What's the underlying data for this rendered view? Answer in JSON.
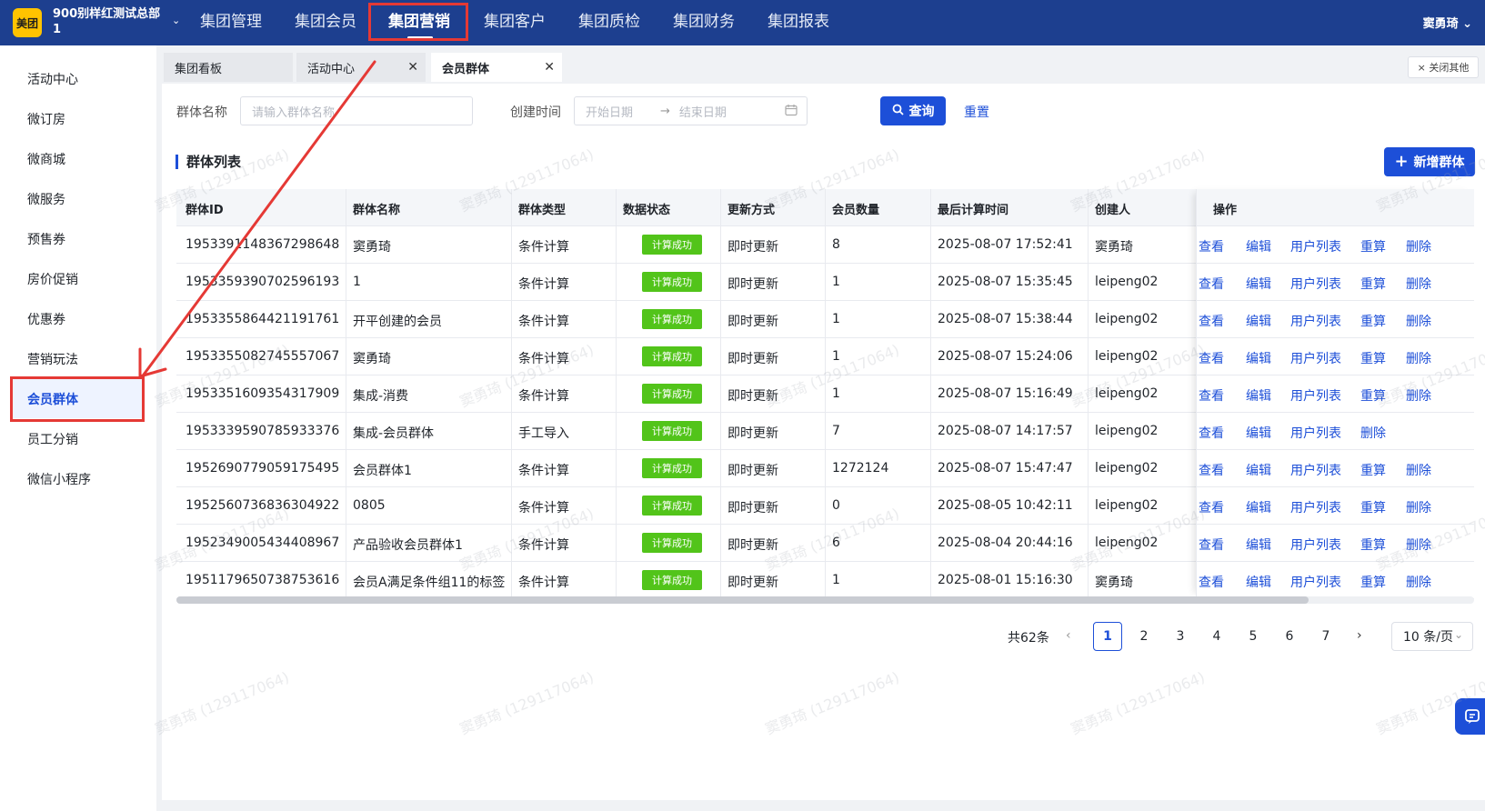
{
  "org": {
    "name_line1": "900别样红测试总部",
    "name_line2": "1",
    "logo_text": "美团"
  },
  "nav": {
    "items": [
      "集团管理",
      "集团会员",
      "集团营销",
      "集团客户",
      "集团质检",
      "集团财务",
      "集团报表"
    ],
    "active": "集团营销"
  },
  "user": {
    "name": "窦勇琦 ⌄"
  },
  "sidebar": {
    "items": [
      "活动中心",
      "微订房",
      "微商城",
      "微服务",
      "预售券",
      "房价促销",
      "优惠券",
      "营销玩法",
      "会员群体",
      "员工分销",
      "微信小程序"
    ],
    "active": "会员群体"
  },
  "tabs": [
    {
      "label": "集团看板",
      "closable": false
    },
    {
      "label": "活动中心",
      "closable": true
    },
    {
      "label": "会员群体",
      "closable": true
    }
  ],
  "close_others_label": "× 关闭其他",
  "filters": {
    "group_name_label": "群体名称",
    "group_name_placeholder": "请输入群体名称",
    "created_time_label": "创建时间",
    "start_placeholder": "开始日期",
    "end_placeholder": "结束日期",
    "range_sep": "→",
    "query_label": "查询",
    "reset_label": "重置"
  },
  "section": {
    "title": "群体列表",
    "add_label": "新增群体"
  },
  "table": {
    "columns": [
      "群体ID",
      "群体名称",
      "群体类型",
      "数据状态",
      "更新方式",
      "会员数量",
      "最后计算时间",
      "创建人",
      "操作"
    ],
    "rows": [
      {
        "id": "1953391148367298648",
        "name": "窦勇琦",
        "type": "条件计算",
        "status": "计算成功",
        "update": "即时更新",
        "count": "8",
        "time": "2025-08-07 17:52:41",
        "creator": "窦勇琦",
        "ops": [
          "查看",
          "编辑",
          "用户列表",
          "重算",
          "删除"
        ]
      },
      {
        "id": "1953359390702596193",
        "name": "1",
        "type": "条件计算",
        "status": "计算成功",
        "update": "即时更新",
        "count": "1",
        "time": "2025-08-07 15:35:45",
        "creator": "leipeng02",
        "ops": [
          "查看",
          "编辑",
          "用户列表",
          "重算",
          "删除"
        ]
      },
      {
        "id": "1953355864421191761",
        "name": "开平创建的会员",
        "type": "条件计算",
        "status": "计算成功",
        "update": "即时更新",
        "count": "1",
        "time": "2025-08-07 15:38:44",
        "creator": "leipeng02",
        "ops": [
          "查看",
          "编辑",
          "用户列表",
          "重算",
          "删除"
        ]
      },
      {
        "id": "1953355082745557067",
        "name": "窦勇琦",
        "type": "条件计算",
        "status": "计算成功",
        "update": "即时更新",
        "count": "1",
        "time": "2025-08-07 15:24:06",
        "creator": "leipeng02",
        "ops": [
          "查看",
          "编辑",
          "用户列表",
          "重算",
          "删除"
        ]
      },
      {
        "id": "1953351609354317909",
        "name": "集成-消费",
        "type": "条件计算",
        "status": "计算成功",
        "update": "即时更新",
        "count": "1",
        "time": "2025-08-07 15:16:49",
        "creator": "leipeng02",
        "ops": [
          "查看",
          "编辑",
          "用户列表",
          "重算",
          "删除"
        ]
      },
      {
        "id": "1953339590785933376",
        "name": "集成-会员群体",
        "type": "手工导入",
        "status": "计算成功",
        "update": "即时更新",
        "count": "7",
        "time": "2025-08-07 14:17:57",
        "creator": "leipeng02",
        "ops": [
          "查看",
          "编辑",
          "用户列表",
          "删除"
        ]
      },
      {
        "id": "1952690779059175495",
        "name": "会员群体1",
        "type": "条件计算",
        "status": "计算成功",
        "update": "即时更新",
        "count": "1272124",
        "time": "2025-08-07 15:47:47",
        "creator": "leipeng02",
        "ops": [
          "查看",
          "编辑",
          "用户列表",
          "重算",
          "删除"
        ]
      },
      {
        "id": "1952560736836304922",
        "name": "0805",
        "type": "条件计算",
        "status": "计算成功",
        "update": "即时更新",
        "count": "0",
        "time": "2025-08-05 10:42:11",
        "creator": "leipeng02",
        "ops": [
          "查看",
          "编辑",
          "用户列表",
          "重算",
          "删除"
        ]
      },
      {
        "id": "1952349005434408967",
        "name": "产品验收会员群体1",
        "type": "条件计算",
        "status": "计算成功",
        "update": "即时更新",
        "count": "6",
        "time": "2025-08-04 20:44:16",
        "creator": "leipeng02",
        "ops": [
          "查看",
          "编辑",
          "用户列表",
          "重算",
          "删除"
        ]
      },
      {
        "id": "1951179650738753616",
        "name": "会员A满足条件组11的标签",
        "type": "条件计算",
        "status": "计算成功",
        "update": "即时更新",
        "count": "1",
        "time": "2025-08-01 15:16:30",
        "creator": "窦勇琦",
        "ops": [
          "查看",
          "编辑",
          "用户列表",
          "重算",
          "删除"
        ]
      }
    ]
  },
  "pagination": {
    "total": "共62条",
    "pages": [
      "1",
      "2",
      "3",
      "4",
      "5",
      "6",
      "7"
    ],
    "current": "1",
    "page_size": "10 条/页"
  },
  "watermark_text": "窦勇琦 (129117064)",
  "colors": {
    "brand": "#1d3f8f",
    "primary": "#1d4fd8",
    "success": "#52c41a",
    "annotation": "#e53935"
  },
  "icons": {
    "search": "search-icon",
    "plus": "plus-icon",
    "calendar": "calendar-icon",
    "help": "chat-help-icon"
  }
}
